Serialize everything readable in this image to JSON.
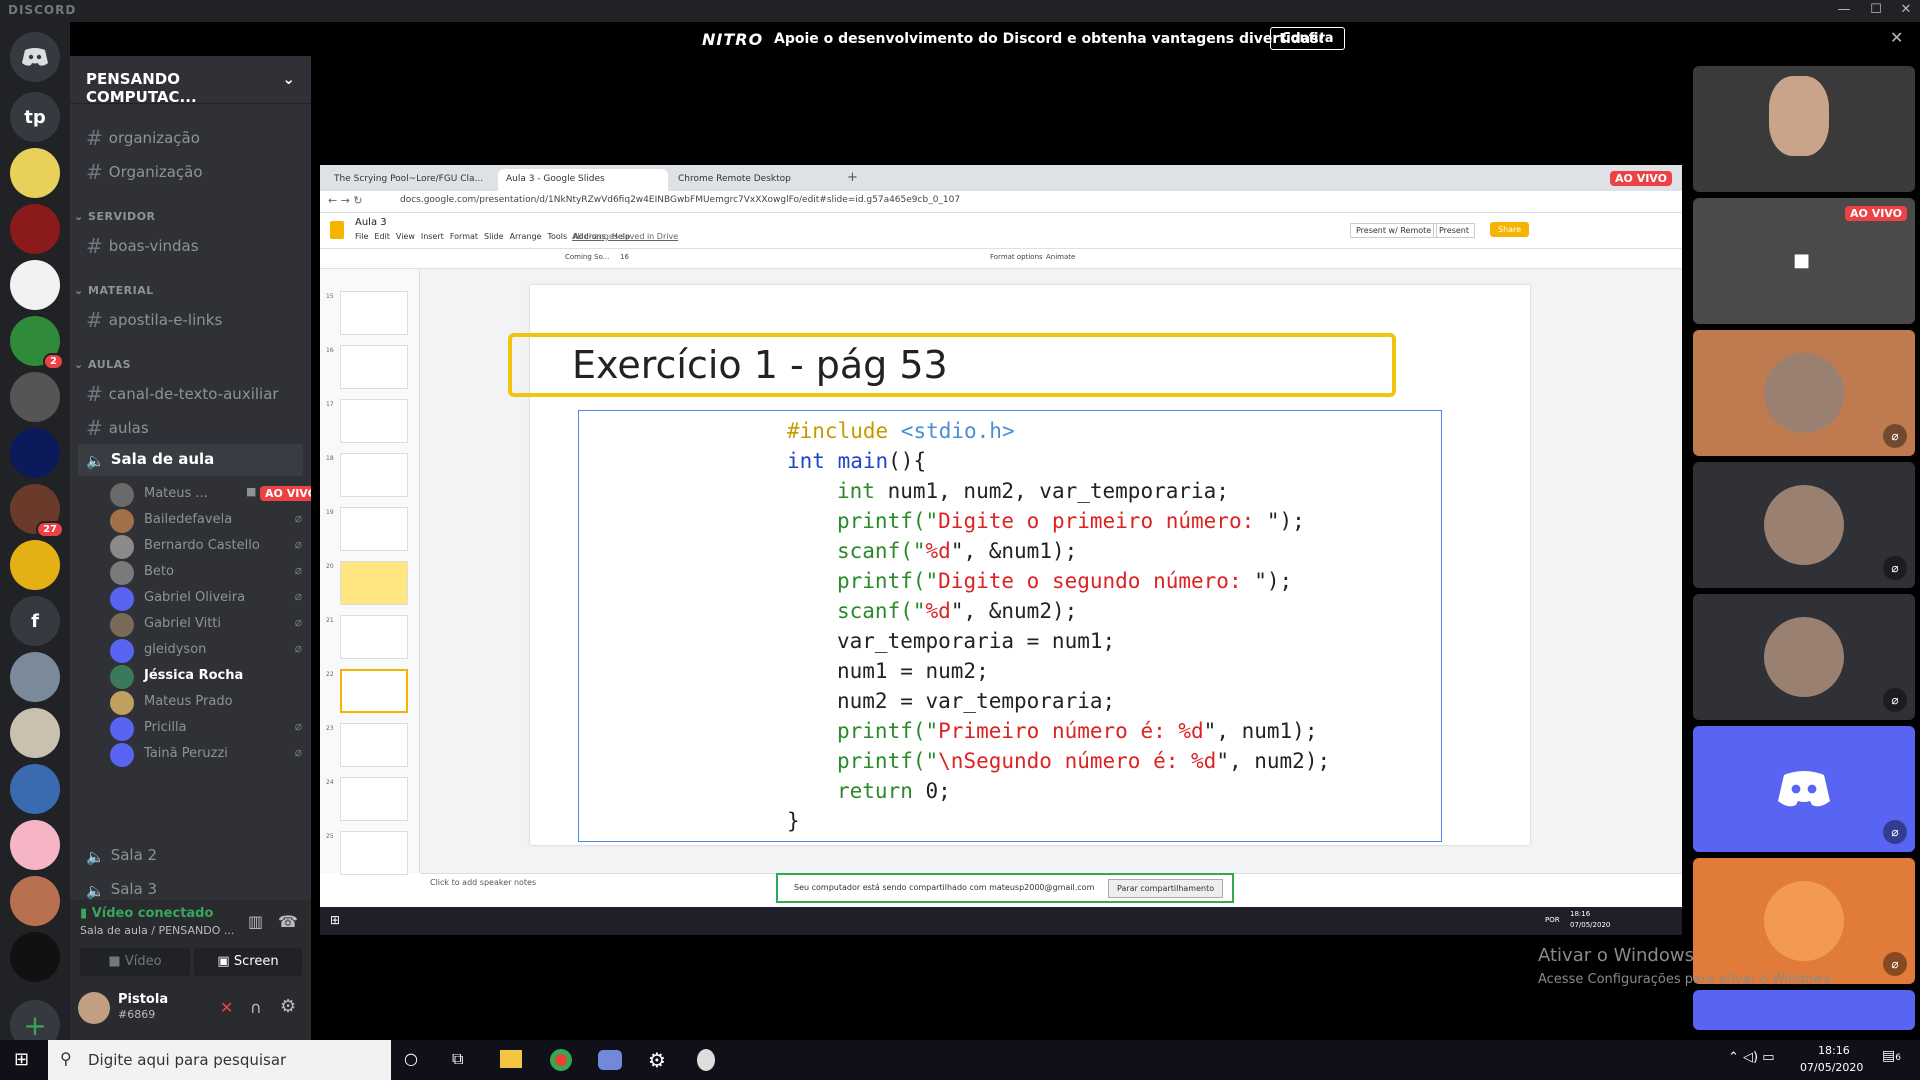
{
  "titlebar": {
    "brand": "DISCORD",
    "min": "—",
    "max": "☐",
    "close": "✕"
  },
  "nitro": {
    "logo": "NITRO",
    "message": "Apoie o desenvolvimento do Discord e obtenha vantagens divertidas!",
    "cta": "Confira",
    "close": "✕"
  },
  "guilds": [
    {
      "label": "tp",
      "color": "#36393f"
    },
    {
      "label": "",
      "color": "#e8d05a"
    },
    {
      "label": "",
      "color": "#8b1a1a"
    },
    {
      "label": "",
      "color": "#f2f2f2"
    },
    {
      "label": "",
      "color": "#2f8a3a",
      "badge": "2"
    },
    {
      "label": "",
      "color": "#555"
    },
    {
      "label": "",
      "color": "#0a1a5a"
    },
    {
      "label": "",
      "color": "#6a3a2a",
      "badge": "27"
    },
    {
      "label": "",
      "color": "#e5b013"
    },
    {
      "label": "f",
      "color": "#36393f"
    },
    {
      "label": "",
      "color": "#7a8a9a"
    },
    {
      "label": "",
      "color": "#c9c0b0"
    },
    {
      "label": "",
      "color": "#3a6ab0"
    },
    {
      "label": "",
      "color": "#f5b5c5"
    },
    {
      "label": "",
      "color": "#b87050"
    },
    {
      "label": "",
      "color": "#111"
    }
  ],
  "server": {
    "name": "PENSANDO COMPUTAC..."
  },
  "channels": {
    "top": [
      {
        "name": "organização"
      },
      {
        "name": "Organização"
      }
    ],
    "cat_servidor": "SERVIDOR",
    "servidor": [
      {
        "name": "boas-vindas"
      }
    ],
    "cat_material": "MATERIAL",
    "material": [
      {
        "name": "apostila-e-links"
      }
    ],
    "cat_aulas": "AULAS",
    "aulas": [
      {
        "name": "canal-de-texto-auxiliar"
      },
      {
        "name": "aulas"
      }
    ],
    "voice_active": "Sala de aula",
    "voice_users": [
      {
        "name": "Mateus ...",
        "live": "AO VIVO",
        "muted": false
      },
      {
        "name": "Bailedefavela",
        "muted": true
      },
      {
        "name": "Bernardo Castello",
        "muted": true
      },
      {
        "name": "Beto",
        "muted": true
      },
      {
        "name": "Gabriel Oliveira",
        "muted": true
      },
      {
        "name": "Gabriel Vitti",
        "muted": true
      },
      {
        "name": "gleidyson",
        "muted": true
      },
      {
        "name": "Jéssica Rocha",
        "muted": false,
        "speaking": true
      },
      {
        "name": "Mateus Prado",
        "muted": false
      },
      {
        "name": "Pricilla",
        "muted": true
      },
      {
        "name": "Tainã Peruzzi",
        "muted": true
      }
    ],
    "voice_other": [
      {
        "name": "Sala 2"
      },
      {
        "name": "Sala 3"
      }
    ]
  },
  "voice_connection": {
    "status": "Vídeo conectado",
    "channel": "Sala de aula / PENSANDO ...",
    "video_btn": "Vídeo",
    "screen_btn": "Screen"
  },
  "user": {
    "name": "Pistola",
    "tag": "#6869"
  },
  "chrome": {
    "tabs": [
      {
        "title": "The Scrying Pool~Lore/FGU Cla..."
      },
      {
        "title": "Aula 3 - Google Slides"
      },
      {
        "title": "Chrome Remote Desktop"
      }
    ],
    "url": "docs.google.com/presentation/d/1NkNtyRZwVd6fiq2w4EINBGwbFMUemgrc7VxXXowglFo/edit#slide=id.g57a465e9cb_0_107",
    "live_badge": "AO VIVO"
  },
  "slides": {
    "doc_title": "Aula 3",
    "menu": [
      "File",
      "Edit",
      "View",
      "Insert",
      "Format",
      "Slide",
      "Arrange",
      "Tools",
      "Add-ons",
      "Help"
    ],
    "saved": "All changes saved in Drive",
    "present_remote": "Present w/ Remote",
    "present": "Present",
    "share": "Share",
    "font": "Coming So...",
    "font_size": "16",
    "format_options": "Format options",
    "animate": "Animate",
    "thumb_numbers": [
      "15",
      "16",
      "17",
      "18",
      "19",
      "20",
      "21",
      "22",
      "23",
      "24",
      "25"
    ],
    "slide_title": "Exercício 1 - pág 53",
    "speaker_notes": "Click to add speaker notes",
    "share_bar": "Seu computador está sendo compartilhado com mateusp2000@gmail.com",
    "stop_share": "Parar compartilhamento",
    "remote_clock": "18:16",
    "remote_date": "07/05/2020",
    "remote_lang": "POR"
  },
  "code": {
    "l1a": "#include ",
    "l1b": "<stdio.h>",
    "l2a": "int ",
    "l2b": "main",
    "l2c": "(){",
    "l3a": "int ",
    "l3b": "num1, num2, var_temporaria;",
    "l4a": "printf(\"",
    "l4b": "Digite o primeiro número: ",
    "l4c": "\");",
    "l5a": "scanf(\"",
    "l5b": "%d",
    "l5c": "\", &num1);",
    "l6a": "printf(\"",
    "l6b": "Digite o segundo número: ",
    "l6c": "\");",
    "l7a": "scanf(\"",
    "l7b": "%d",
    "l7c": "\", &num2);",
    "l8": "var_temporaria = num1;",
    "l9": "num1 = num2;",
    "l10": "num2 = var_temporaria;",
    "l11a": "printf(\"",
    "l11b": "Primeiro número é: %d",
    "l11c": "\", num1);",
    "l12a": "printf(\"",
    "l12b": "\\nSegundo número é: %d",
    "l12c": "\", num2);",
    "l13a": "return ",
    "l13b": "0;",
    "l14": "}"
  },
  "tiles": {
    "live_badge": "AO VIVO",
    "colors": [
      "#3a3a3a",
      "#4a4a4a",
      "#c07a50",
      "#2f3136",
      "#2f3136",
      "#5865f2",
      "#e07b39",
      "#5865f2"
    ]
  },
  "watermark": {
    "title": "Ativar o Windows",
    "sub": "Acesse Configurações para ativar o Windows."
  },
  "taskbar": {
    "search": "Digite aqui para pesquisar",
    "time": "18:16",
    "date": "07/05/2020",
    "notif": "6"
  }
}
